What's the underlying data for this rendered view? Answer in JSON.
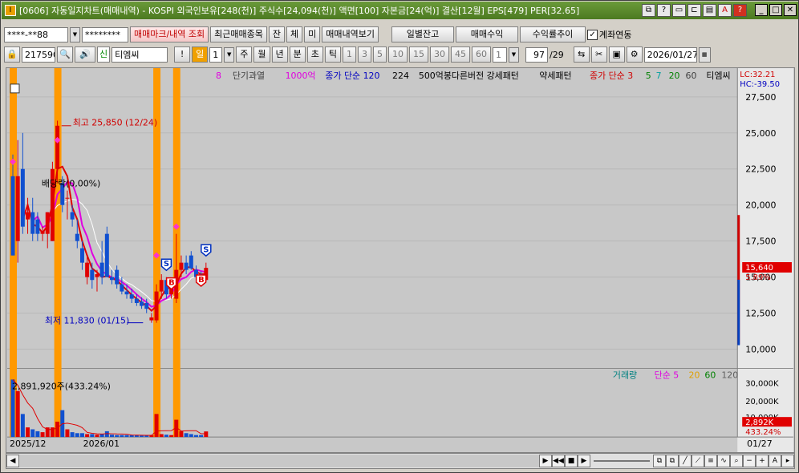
{
  "title": "[0606] 자동일지차트(매매내역) - KOSPI 외국인보유[248(천)] 주식수[24,094(천)] 액면[100] 자본금[24(억)] 결산[12월] EPS[479] PER[32.65]",
  "toolbar1": {
    "account": "****-**88",
    "password": "********",
    "b1": "매매마크/내역 조회",
    "b2": "최근매매종목",
    "b3": "잔",
    "b4": "체",
    "b5": "미",
    "b6": "매매내역보기",
    "b7": "일별잔고",
    "b8": "매매수익",
    "b9": "수익률추이",
    "linked": "계좌연동"
  },
  "toolbar2": {
    "code": "217590",
    "name": "티엠씨",
    "new": "신",
    "periods": [
      "일",
      "1",
      "주",
      "월",
      "년",
      "분",
      "초",
      "틱",
      "1",
      "3",
      "5",
      "10",
      "15",
      "30",
      "45",
      "60",
      "1"
    ],
    "count": "97",
    "total": "/29",
    "date": "2026/01/27"
  },
  "legend_top": [
    "8",
    "단기과열",
    "1000억",
    "종가 단순 120",
    "224",
    "500억봉다른버전 강세패턴",
    "약세패턴",
    "종가 단순 3",
    "5",
    "7",
    "20",
    "60",
    "티엠씨"
  ],
  "legend_colors": {
    "m8": "#e000e0",
    "m1000": "#e000e0",
    "c120": "#0000c0",
    "c224": "#000000",
    "c3": "#d00000",
    "c5": "#008000",
    "c7": "#00a0a0",
    "c20": "#008000",
    "c60": "#404040"
  },
  "lc": "LC:32.21",
  "hc": "HC:-39.50",
  "price_axis": [
    "27,500",
    "25,000",
    "22,500",
    "20,000",
    "17,500",
    "15,000",
    "12,500",
    "10,000"
  ],
  "cur_price": "15,640",
  "cur_pct": "5.89%",
  "high_label": "최고 25,850 (12/24)",
  "low_label": "최저 11,830 (01/15)",
  "div_label": "배당락(0,00%)",
  "vol_legend": [
    "거래량",
    "단순 5",
    "20",
    "60",
    "120"
  ],
  "vol_axis": [
    "30,000K",
    "20,000K",
    "10,000K"
  ],
  "vol_cur": "2,892K",
  "vol_pct": "433.24%",
  "vol_label": "2,891,920주(433.24%)",
  "x_labels": [
    "2025/12",
    "2026/01"
  ],
  "x_right": "01/27",
  "chart_data": {
    "type": "candlestick",
    "ylim": [
      10000,
      27500
    ],
    "candles": [
      {
        "o": 22000,
        "h": 23500,
        "l": 16500,
        "c": 16500
      },
      {
        "o": 17500,
        "h": 24500,
        "l": 16000,
        "c": 22000
      },
      {
        "o": 22500,
        "h": 25000,
        "l": 18000,
        "c": 18500
      },
      {
        "o": 19000,
        "h": 20500,
        "l": 18000,
        "c": 19500
      },
      {
        "o": 19500,
        "h": 20500,
        "l": 17500,
        "c": 18000
      },
      {
        "o": 19000,
        "h": 19500,
        "l": 17500,
        "c": 18000
      },
      {
        "o": 18000,
        "h": 18500,
        "l": 17500,
        "c": 18200
      },
      {
        "o": 18000,
        "h": 19500,
        "l": 17000,
        "c": 19500
      },
      {
        "o": 17500,
        "h": 23000,
        "l": 17500,
        "c": 22500
      },
      {
        "o": 22500,
        "h": 25850,
        "l": 21500,
        "c": 25500
      },
      {
        "o": 21500,
        "h": 22000,
        "l": 19500,
        "c": 20000
      },
      {
        "o": 20500,
        "h": 21000,
        "l": 19000,
        "c": 20500
      },
      {
        "o": 19500,
        "h": 20000,
        "l": 18500,
        "c": 19000
      },
      {
        "o": 18000,
        "h": 19000,
        "l": 17000,
        "c": 17500
      },
      {
        "o": 17000,
        "h": 17500,
        "l": 15500,
        "c": 16000
      },
      {
        "o": 15000,
        "h": 16500,
        "l": 14500,
        "c": 16000
      },
      {
        "o": 15500,
        "h": 16000,
        "l": 14200,
        "c": 14800
      },
      {
        "o": 15000,
        "h": 15500,
        "l": 14000,
        "c": 15200
      },
      {
        "o": 16000,
        "h": 17500,
        "l": 14500,
        "c": 15000
      },
      {
        "o": 18000,
        "h": 18500,
        "l": 15000,
        "c": 15000
      },
      {
        "o": 15000,
        "h": 15500,
        "l": 14500,
        "c": 14800
      },
      {
        "o": 15500,
        "h": 15800,
        "l": 14200,
        "c": 14500
      },
      {
        "o": 14500,
        "h": 15000,
        "l": 13800,
        "c": 14000
      },
      {
        "o": 14000,
        "h": 14500,
        "l": 13500,
        "c": 13800
      },
      {
        "o": 13800,
        "h": 14200,
        "l": 13200,
        "c": 13500
      },
      {
        "o": 13500,
        "h": 13800,
        "l": 13000,
        "c": 13200
      },
      {
        "o": 13300,
        "h": 13600,
        "l": 12800,
        "c": 13000
      },
      {
        "o": 13200,
        "h": 13500,
        "l": 12500,
        "c": 12800
      },
      {
        "o": 12000,
        "h": 12500,
        "l": 11830,
        "c": 12200
      },
      {
        "o": 12000,
        "h": 14500,
        "l": 11830,
        "c": 14000
      },
      {
        "o": 14000,
        "h": 15200,
        "l": 13500,
        "c": 14800
      },
      {
        "o": 14800,
        "h": 15000,
        "l": 13500,
        "c": 13800
      },
      {
        "o": 13800,
        "h": 14500,
        "l": 13500,
        "c": 14200
      },
      {
        "o": 13500,
        "h": 18000,
        "l": 13200,
        "c": 15500
      },
      {
        "o": 15500,
        "h": 16500,
        "l": 15000,
        "c": 16000
      },
      {
        "o": 16000,
        "h": 16500,
        "l": 15200,
        "c": 15500
      },
      {
        "o": 16500,
        "h": 16800,
        "l": 15500,
        "c": 15600
      },
      {
        "o": 15500,
        "h": 15800,
        "l": 14800,
        "c": 15000
      },
      {
        "o": 15200,
        "h": 15400,
        "l": 14600,
        "c": 15000
      },
      {
        "o": 14800,
        "h": 16000,
        "l": 14700,
        "c": 15640
      }
    ],
    "volume": [
      30000,
      24000,
      12000,
      5000,
      4000,
      3000,
      2500,
      5000,
      5000,
      8000,
      14000,
      4000,
      2500,
      2000,
      2000,
      1500,
      1500,
      1200,
      1500,
      3000,
      1200,
      1000,
      1000,
      1000,
      900,
      900,
      800,
      800,
      900,
      12000,
      1500,
      1200,
      1000,
      9000,
      3000,
      2000,
      1500,
      1000,
      1000,
      2892
    ]
  }
}
